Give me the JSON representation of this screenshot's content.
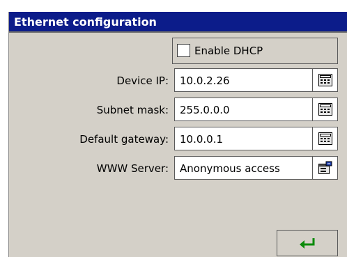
{
  "window": {
    "title": "Ethernet configuration"
  },
  "dhcp": {
    "label": "Enable DHCP",
    "checked": false
  },
  "fields": [
    {
      "label": "Device IP:",
      "value": "10.0.2.26",
      "icon": "keypad-icon"
    },
    {
      "label": "Subnet mask:",
      "value": "255.0.0.0",
      "icon": "keypad-icon"
    },
    {
      "label": "Default gateway:",
      "value": "10.0.0.1",
      "icon": "keypad-icon"
    },
    {
      "label": "WWW Server:",
      "value": "Anonymous access",
      "icon": "settings-dialog-icon"
    }
  ],
  "ok_button": {
    "icon": "enter-arrow-icon",
    "color": "#0a8a0a"
  },
  "colors": {
    "titlebar": "#0c1c8a",
    "background": "#d4d0c8"
  }
}
